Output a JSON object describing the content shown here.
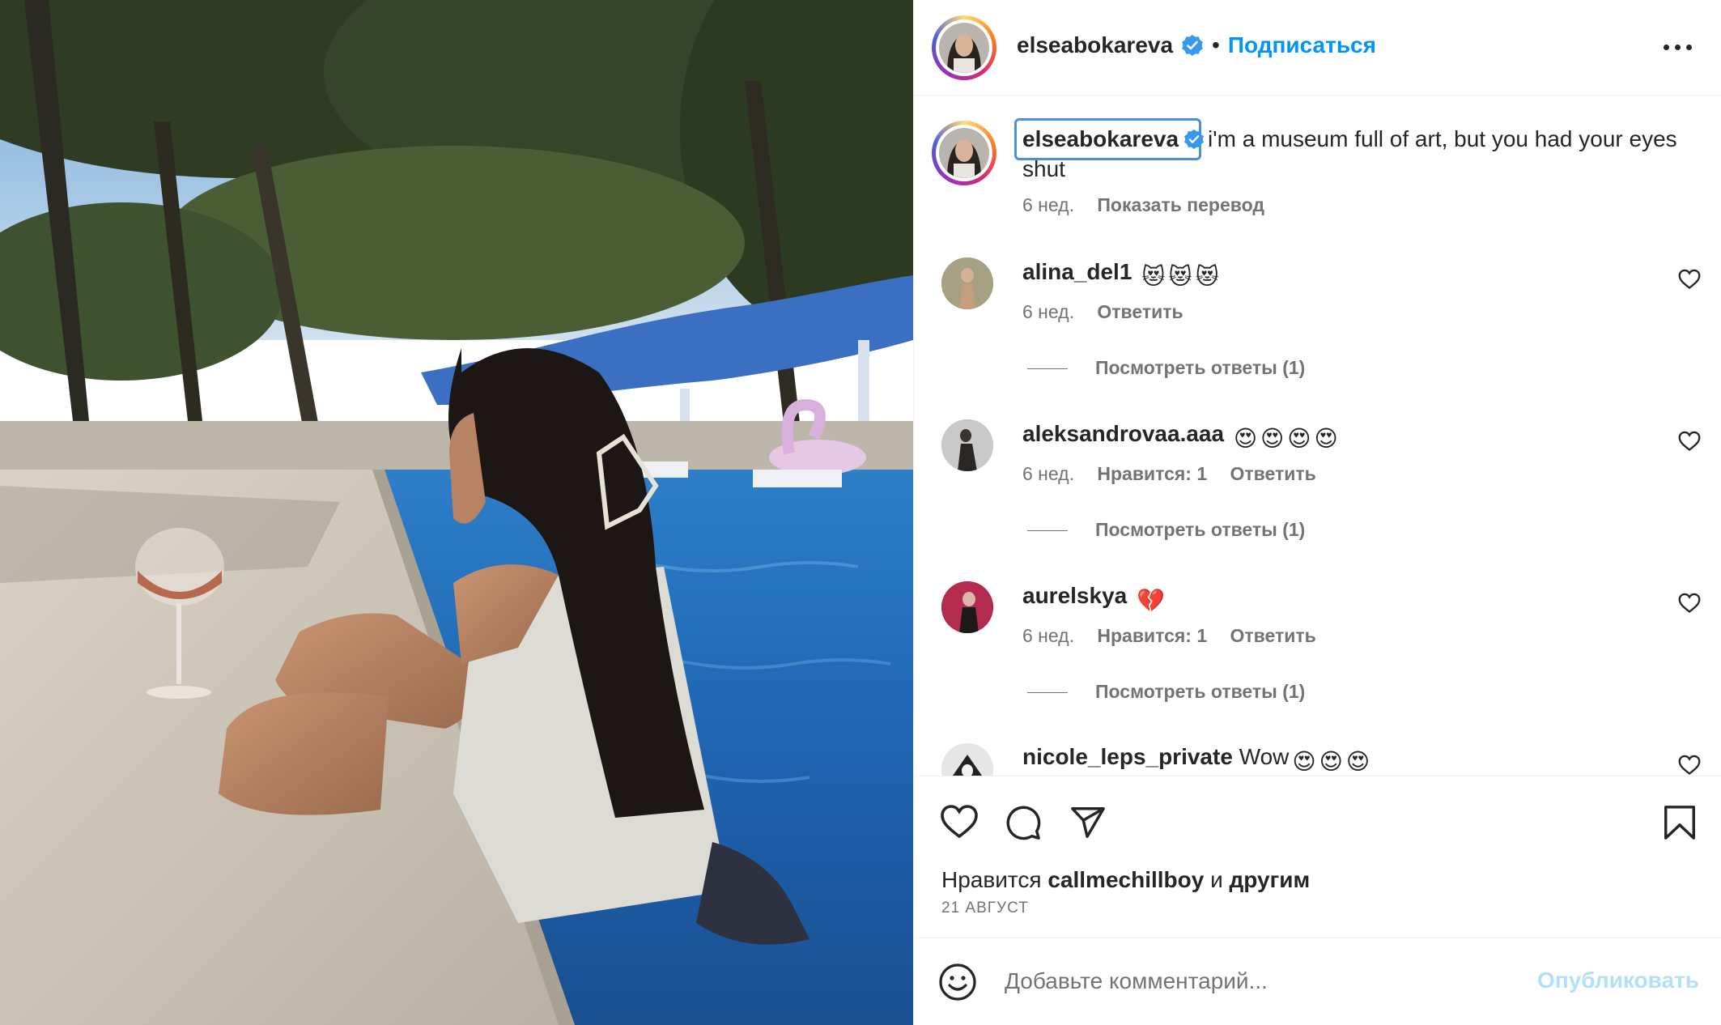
{
  "post": {
    "author": "elseabokareva",
    "follow_label": "Подписаться",
    "separator": "•"
  },
  "caption": {
    "author": "elseabokareva",
    "text": "i'm a museum full of art, but you had your eyes shut",
    "time": "6 нед.",
    "translate_label": "Показать перевод"
  },
  "comments": [
    {
      "user": "alina_del1",
      "text": "",
      "emoji": [
        "smiling-cat-heart-eyes",
        "smiling-cat-heart-eyes",
        "smiling-cat-heart-eyes"
      ],
      "time": "6 нед.",
      "likes": "",
      "reply": "Ответить",
      "view_replies": "Посмотреть ответы (1)"
    },
    {
      "user": "aleksandrovaa.aaa",
      "text": "",
      "emoji": [
        "heart-eyes",
        "heart-eyes",
        "heart-eyes",
        "heart-eyes"
      ],
      "time": "6 нед.",
      "likes": "Нравится: 1",
      "reply": "Ответить",
      "view_replies": "Посмотреть ответы (1)"
    },
    {
      "user": "aurelskya",
      "text": "",
      "emoji": [
        "broken-heart"
      ],
      "time": "6 нед.",
      "likes": "Нравится: 1",
      "reply": "Ответить",
      "view_replies": "Посмотреть ответы (1)"
    },
    {
      "user": "nicole_leps_private",
      "text": "Wow",
      "emoji": [
        "heart-eyes",
        "heart-eyes",
        "heart-eyes"
      ],
      "time": "",
      "likes": "",
      "reply": "",
      "view_replies": ""
    }
  ],
  "likes_line": {
    "prefix": "Нравится",
    "user": "callmechillboy",
    "middle": "и",
    "suffix": "другим"
  },
  "date": "21 АВГУСТ",
  "comment_box": {
    "placeholder": "Добавьте комментарий...",
    "post_label": "Опубликовать"
  },
  "colors": {
    "accent": "#0095f6",
    "verified": "#3897f0",
    "post_disabled": "#b2dffc",
    "secondary_text": "#737373"
  },
  "icons": [
    "more-options-icon",
    "heart-icon",
    "comment-icon",
    "share-icon",
    "bookmark-icon",
    "emoji-icon",
    "verified-badge-icon"
  ]
}
